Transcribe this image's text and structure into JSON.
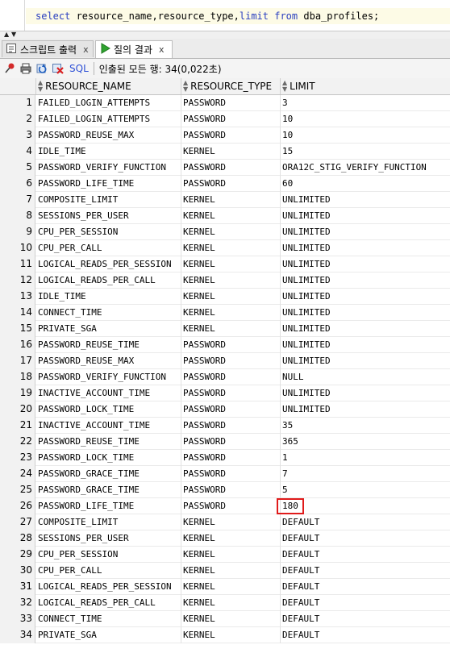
{
  "editor": {
    "kw_select": "select",
    "columns_text": " resource_name,resource_type,",
    "kw_limit": "limit",
    "space": " ",
    "kw_from": "from",
    "table_text": " dba_profiles;"
  },
  "tabs": [
    {
      "label": "스크립트 출력",
      "close": "x",
      "icon": "script-output-icon"
    },
    {
      "label": "질의 결과",
      "close": "x",
      "icon": "run-query-icon"
    }
  ],
  "toolbar": {
    "sql_label": "SQL",
    "separator": "|",
    "status": "인출된 모든 행: 34(0,022초)"
  },
  "colors": {
    "sql_keyword": "#2a3fbf",
    "highlight_box": "#e01b1b",
    "sql_link": "#2d4fd6"
  },
  "highlighted_row": 26,
  "grid": {
    "columns": [
      "RESOURCE_NAME",
      "RESOURCE_TYPE",
      "LIMIT"
    ],
    "rows": [
      {
        "n": "1",
        "name": "FAILED_LOGIN_ATTEMPTS",
        "type": "PASSWORD",
        "limit": "3"
      },
      {
        "n": "2",
        "name": "FAILED_LOGIN_ATTEMPTS",
        "type": "PASSWORD",
        "limit": "10"
      },
      {
        "n": "3",
        "name": "PASSWORD_REUSE_MAX",
        "type": "PASSWORD",
        "limit": "10"
      },
      {
        "n": "4",
        "name": "IDLE_TIME",
        "type": "KERNEL",
        "limit": "15"
      },
      {
        "n": "5",
        "name": "PASSWORD_VERIFY_FUNCTION",
        "type": "PASSWORD",
        "limit": "ORA12C_STIG_VERIFY_FUNCTION"
      },
      {
        "n": "6",
        "name": "PASSWORD_LIFE_TIME",
        "type": "PASSWORD",
        "limit": "60"
      },
      {
        "n": "7",
        "name": "COMPOSITE_LIMIT",
        "type": "KERNEL",
        "limit": "UNLIMITED"
      },
      {
        "n": "8",
        "name": "SESSIONS_PER_USER",
        "type": "KERNEL",
        "limit": "UNLIMITED"
      },
      {
        "n": "9",
        "name": "CPU_PER_SESSION",
        "type": "KERNEL",
        "limit": "UNLIMITED"
      },
      {
        "n": "10",
        "name": "CPU_PER_CALL",
        "type": "KERNEL",
        "limit": "UNLIMITED"
      },
      {
        "n": "11",
        "name": "LOGICAL_READS_PER_SESSION",
        "type": "KERNEL",
        "limit": "UNLIMITED"
      },
      {
        "n": "12",
        "name": "LOGICAL_READS_PER_CALL",
        "type": "KERNEL",
        "limit": "UNLIMITED"
      },
      {
        "n": "13",
        "name": "IDLE_TIME",
        "type": "KERNEL",
        "limit": "UNLIMITED"
      },
      {
        "n": "14",
        "name": "CONNECT_TIME",
        "type": "KERNEL",
        "limit": "UNLIMITED"
      },
      {
        "n": "15",
        "name": "PRIVATE_SGA",
        "type": "KERNEL",
        "limit": "UNLIMITED"
      },
      {
        "n": "16",
        "name": "PASSWORD_REUSE_TIME",
        "type": "PASSWORD",
        "limit": "UNLIMITED"
      },
      {
        "n": "17",
        "name": "PASSWORD_REUSE_MAX",
        "type": "PASSWORD",
        "limit": "UNLIMITED"
      },
      {
        "n": "18",
        "name": "PASSWORD_VERIFY_FUNCTION",
        "type": "PASSWORD",
        "limit": "NULL"
      },
      {
        "n": "19",
        "name": "INACTIVE_ACCOUNT_TIME",
        "type": "PASSWORD",
        "limit": "UNLIMITED"
      },
      {
        "n": "20",
        "name": "PASSWORD_LOCK_TIME",
        "type": "PASSWORD",
        "limit": "UNLIMITED"
      },
      {
        "n": "21",
        "name": "INACTIVE_ACCOUNT_TIME",
        "type": "PASSWORD",
        "limit": "35"
      },
      {
        "n": "22",
        "name": "PASSWORD_REUSE_TIME",
        "type": "PASSWORD",
        "limit": "365"
      },
      {
        "n": "23",
        "name": "PASSWORD_LOCK_TIME",
        "type": "PASSWORD",
        "limit": "1"
      },
      {
        "n": "24",
        "name": "PASSWORD_GRACE_TIME",
        "type": "PASSWORD",
        "limit": "7"
      },
      {
        "n": "25",
        "name": "PASSWORD_GRACE_TIME",
        "type": "PASSWORD",
        "limit": "5"
      },
      {
        "n": "26",
        "name": "PASSWORD_LIFE_TIME",
        "type": "PASSWORD",
        "limit": "180"
      },
      {
        "n": "27",
        "name": "COMPOSITE_LIMIT",
        "type": "KERNEL",
        "limit": "DEFAULT"
      },
      {
        "n": "28",
        "name": "SESSIONS_PER_USER",
        "type": "KERNEL",
        "limit": "DEFAULT"
      },
      {
        "n": "29",
        "name": "CPU_PER_SESSION",
        "type": "KERNEL",
        "limit": "DEFAULT"
      },
      {
        "n": "30",
        "name": "CPU_PER_CALL",
        "type": "KERNEL",
        "limit": "DEFAULT"
      },
      {
        "n": "31",
        "name": "LOGICAL_READS_PER_SESSION",
        "type": "KERNEL",
        "limit": "DEFAULT"
      },
      {
        "n": "32",
        "name": "LOGICAL_READS_PER_CALL",
        "type": "KERNEL",
        "limit": "DEFAULT"
      },
      {
        "n": "33",
        "name": "CONNECT_TIME",
        "type": "KERNEL",
        "limit": "DEFAULT"
      },
      {
        "n": "34",
        "name": "PRIVATE_SGA",
        "type": "KERNEL",
        "limit": "DEFAULT"
      }
    ]
  }
}
